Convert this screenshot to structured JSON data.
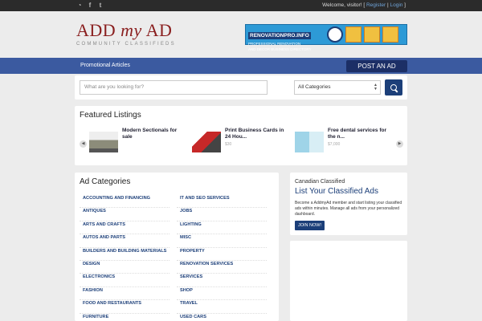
{
  "topbar": {
    "social_icons": [
      "rss-icon",
      "facebook-icon",
      "twitter-icon"
    ],
    "welcome": "Welcome, visitor!",
    "sep_open": " [ ",
    "register": "Register",
    "sep_mid": " | ",
    "login": "Login",
    "sep_close": " ]"
  },
  "logo": {
    "word1": "ADD ",
    "word2": "my",
    "word3": " AD",
    "tagline": "COMMUNITY CLASSIFIEDS"
  },
  "banner": {
    "name": "RENOVATIONPRO.INFO",
    "line1": "PROFESSIONAL RENOVATION",
    "line2": "AND DECOR BUSINESS DIRECTORY"
  },
  "nav": {
    "promo": "Promotional Articles",
    "post_ad": "POST AN AD"
  },
  "search": {
    "placeholder": "What are you looking for?",
    "category": "All Categories"
  },
  "featured": {
    "title": "Featured Listings",
    "items": [
      {
        "title": "Modern Sectionals for sale",
        "price": ""
      },
      {
        "title": "Print Business Cards in 24 Hou...",
        "price": "$30"
      },
      {
        "title": "Free dental services for the n...",
        "price": "$7,000"
      }
    ]
  },
  "categories": {
    "title": "Ad Categories",
    "col1": [
      "ACCOUNTING AND FINANCING",
      "ANTIQUES",
      "ARTS AND CRAFTS",
      "AUTOS AND PARTS",
      "BUILDERS AND BUILDING MATERIALS",
      "DESIGN",
      "ELECTRONICS",
      "FASHION",
      "FOOD AND RESTAURANTS",
      "FURNITURE"
    ],
    "col2": [
      "IT AND SEO SERVICES",
      "JOBS",
      "LIGHTING",
      "MISC",
      "PROPERTY",
      "RENOVATION SERVICES",
      "SERVICES",
      "SHOP",
      "TRAVEL",
      "USED CARS"
    ]
  },
  "classified": {
    "subtitle": "Canadian Classified",
    "title": "List Your Classified Ads",
    "desc": "Become a AddmyAd member and start listing your classified ads within minutes. Manage all ads from your personalized dashboard.",
    "join": "JOIN NOW!"
  },
  "colors": {
    "nav": "#3b5aa0",
    "accent": "#1c3f79",
    "logo": "#8a1f1f"
  }
}
